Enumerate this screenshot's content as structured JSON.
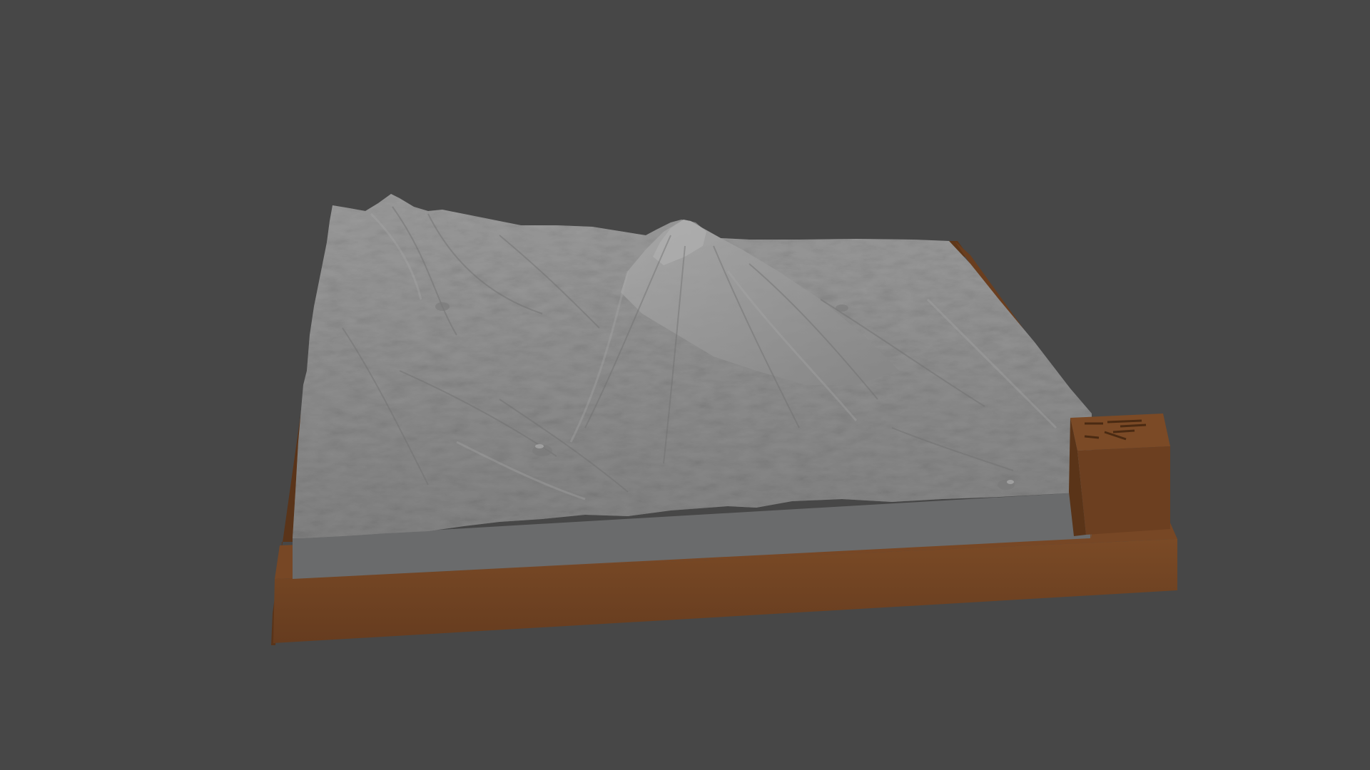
{
  "viewport": {
    "background_color": "#474747"
  },
  "model": {
    "terrain_color": "#8f8f8f",
    "base_color": "#6d4122",
    "insert_color": "#6a6b6c",
    "features": [
      "terrain-mesh",
      "volcano-peak",
      "base-frame",
      "label-block"
    ]
  }
}
